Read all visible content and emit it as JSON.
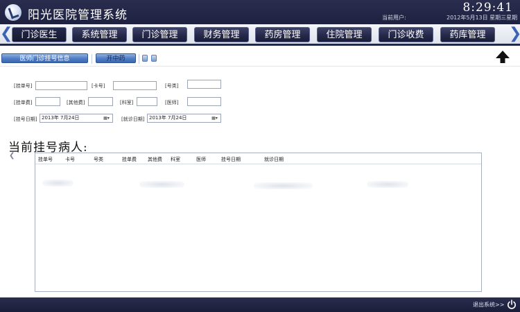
{
  "header": {
    "title": "阳光医院管理系统",
    "clock": "8:29:41",
    "user_label": "当前用户:",
    "user_name": "",
    "date": "2012年5月13日 星期三星期"
  },
  "nav": {
    "tabs": [
      "门诊医生",
      "系统管理",
      "门诊管理",
      "财务管理",
      "药房管理",
      "住院管理",
      "门诊收费",
      "药库管理"
    ],
    "active_index": 0
  },
  "toolbar": {
    "button_1": "医师门诊挂号信息",
    "button_2": "开中药"
  },
  "form": {
    "labels": {
      "reg_no": "[挂单号]",
      "card_no": "[卡号]",
      "type": "[号类]",
      "reg_fee": "[挂单费]",
      "other_fee": "[其他费]",
      "department": "[科室]",
      "doctor": "[医师]",
      "reg_date": "[挂号日期]",
      "visit_date": "[就诊日期]"
    },
    "values": {
      "reg_no": "",
      "card_no": "",
      "type": "",
      "reg_fee": "",
      "other_fee": "",
      "department": "",
      "doctor": "",
      "reg_date": "2013年 7月24日",
      "visit_date": "2013年 7月24日"
    }
  },
  "section": {
    "title": "当前挂号病人:"
  },
  "table": {
    "columns": [
      "挂单号",
      "卡号",
      "号类",
      "挂单费",
      "其他费",
      "科室",
      "医师",
      "挂号日期",
      "就诊日期"
    ],
    "rows": []
  },
  "footer": {
    "logout": "退出系统>>"
  },
  "colors": {
    "header_bg": "#1e2140",
    "tab_bg": "#242746",
    "button_blue": "#4e7cc4"
  }
}
